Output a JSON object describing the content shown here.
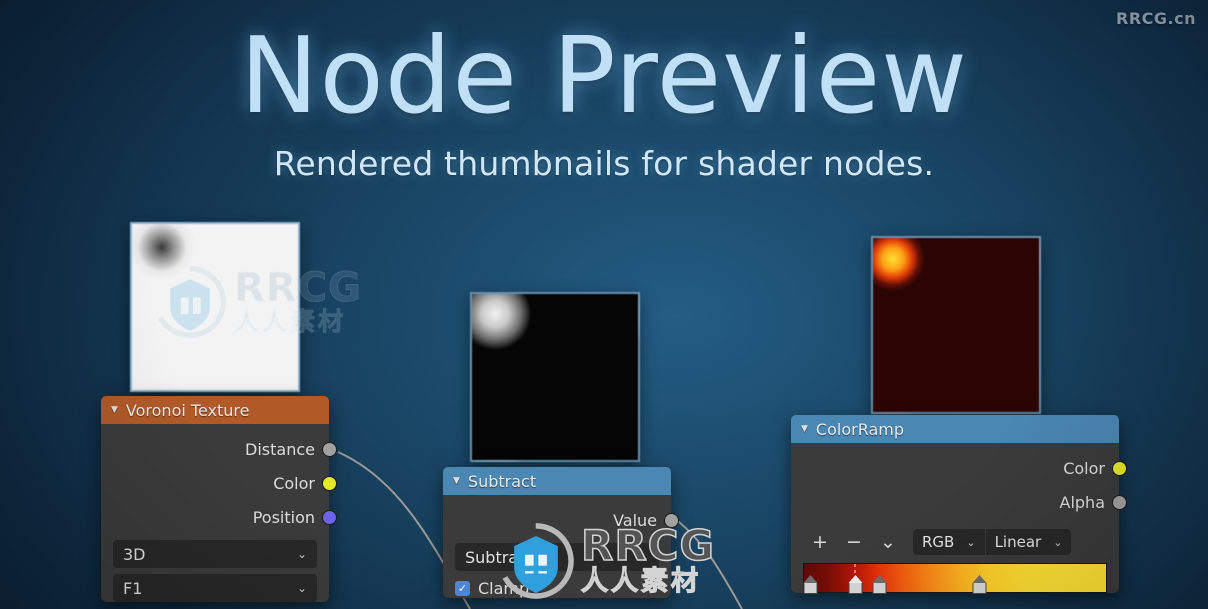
{
  "hero": {
    "title": "Node Preview",
    "subtitle": "Rendered thumbnails for shader nodes."
  },
  "watermarks": {
    "corner": "RRCG.cn",
    "center_latin": "RRCG",
    "center_cjk": "人人素材"
  },
  "colors": {
    "background_deep": "#0a1f33",
    "background_light": "#245d85",
    "header_orange": "#b15a28",
    "header_blue": "#4a87b3",
    "socket_gray": "#a1a1a1",
    "socket_yellow": "#e7e729",
    "socket_purple": "#6b63e8",
    "checkbox_blue": "#4a87d8",
    "node_body": "#3b3b3b"
  },
  "nodes": {
    "voronoi": {
      "title": "Voronoi Texture",
      "collapse_icon": "triangle-down-icon",
      "outputs": [
        {
          "label": "Distance",
          "socket": "gray"
        },
        {
          "label": "Color",
          "socket": "yellow"
        },
        {
          "label": "Position",
          "socket": "purple"
        }
      ],
      "dropdowns": [
        {
          "name": "dimensions",
          "value": "3D"
        },
        {
          "name": "feature",
          "value": "F1"
        }
      ]
    },
    "subtract": {
      "title": "Subtract",
      "collapse_icon": "triangle-down-icon",
      "outputs": [
        {
          "label": "Value",
          "socket": "gray"
        }
      ],
      "dropdowns": [
        {
          "name": "operation",
          "value": "Subtract"
        }
      ],
      "checkbox": {
        "label": "Clamp",
        "checked": true
      }
    },
    "colorramp": {
      "title": "ColorRamp",
      "collapse_icon": "triangle-down-icon",
      "outputs": [
        {
          "label": "Color",
          "socket": "yellow"
        },
        {
          "label": "Alpha",
          "socket": "gray"
        }
      ],
      "toolbar": {
        "add_label": "+",
        "remove_label": "−",
        "menu_label": "⌄",
        "color_mode": "RGB",
        "interpolation": "Linear"
      },
      "gradient_stops": [
        {
          "position": 2,
          "color": "#5c0a06",
          "selected": false
        },
        {
          "position": 17,
          "color": "#c41a08",
          "selected": true
        },
        {
          "position": 25,
          "color": "#e33a08",
          "selected": false
        },
        {
          "position": 58,
          "color": "#ffd128",
          "selected": false
        }
      ]
    }
  }
}
